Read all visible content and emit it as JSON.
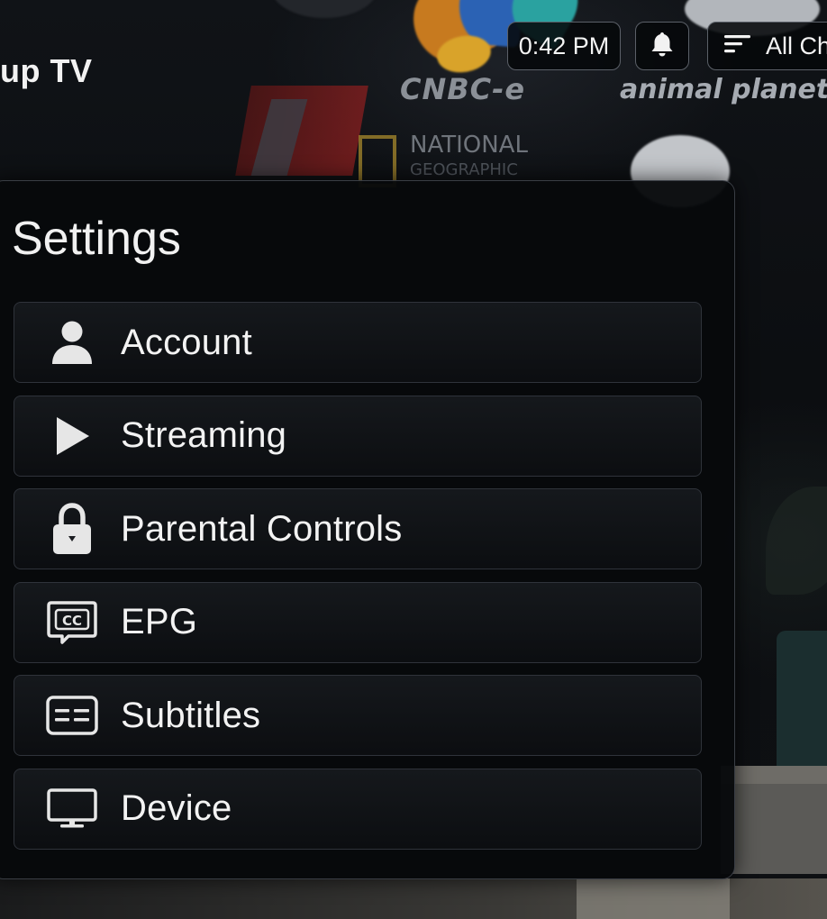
{
  "header": {
    "app_title": "up TV",
    "clock": "0:42 PM",
    "bell_icon": "bell-icon",
    "filter": {
      "icon": "filter-lines-icon",
      "label": "All Ch"
    }
  },
  "background": {
    "logos": [
      "CNBC-e",
      "animal planet",
      "NATIONAL",
      "GEOGRAPHIC"
    ]
  },
  "settings": {
    "title": "Settings",
    "items": [
      {
        "label": "Account",
        "icon": "user-icon"
      },
      {
        "label": "Streaming",
        "icon": "play-icon"
      },
      {
        "label": "Parental Controls",
        "icon": "lock-icon"
      },
      {
        "label": "EPG",
        "icon": "closed-caption-icon"
      },
      {
        "label": "Subtitles",
        "icon": "subtitles-icon"
      },
      {
        "label": "Device",
        "icon": "monitor-icon"
      }
    ]
  },
  "colors": {
    "panel_bg": "#07090b",
    "panel_border": "#3a3e45",
    "item_border": "#2f333a",
    "text": "#f3f3f3",
    "icon": "#e6e6e6"
  }
}
